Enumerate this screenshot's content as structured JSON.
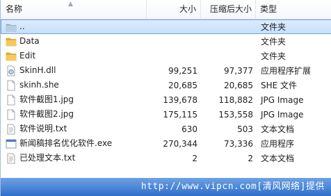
{
  "columns": {
    "name": "名称",
    "size": "大小",
    "compressed_size": "压缩后大小",
    "type": "类型"
  },
  "files": [
    {
      "name": "..",
      "size": "",
      "compressed_size": "",
      "type": "文件夹",
      "icon": "folder-up-icon",
      "selected": true
    },
    {
      "name": "Data",
      "size": "",
      "compressed_size": "",
      "type": "文件夹",
      "icon": "folder-icon",
      "selected": false
    },
    {
      "name": "Edit",
      "size": "",
      "compressed_size": "",
      "type": "文件夹",
      "icon": "folder-icon",
      "selected": false
    },
    {
      "name": "SkinH.dll",
      "size": "99,251",
      "compressed_size": "97,377",
      "type": "应用程序扩展",
      "icon": "dll-file-icon",
      "selected": false
    },
    {
      "name": "skinh.she",
      "size": "20,685",
      "compressed_size": "20,685",
      "type": "SHE 文件",
      "icon": "blank-file-icon",
      "selected": false
    },
    {
      "name": "软件截图1.jpg",
      "size": "139,678",
      "compressed_size": "118,882",
      "type": "JPG Image",
      "icon": "blank-file-icon",
      "selected": false
    },
    {
      "name": "软件截图2.jpg",
      "size": "175,115",
      "compressed_size": "153,558",
      "type": "JPG Image",
      "icon": "blank-file-icon",
      "selected": false
    },
    {
      "name": "软件说明.txt",
      "size": "630",
      "compressed_size": "503",
      "type": "文本文档",
      "icon": "text-file-icon",
      "selected": false
    },
    {
      "name": "新闻稿排名优化软件.exe",
      "size": "270,344",
      "compressed_size": "73,336",
      "type": "应用程序",
      "icon": "exe-file-icon",
      "selected": false
    },
    {
      "name": "已处理文本.txt",
      "size": "2",
      "compressed_size": "2",
      "type": "文本文档",
      "icon": "text-file-icon",
      "selected": false
    }
  ],
  "watermark": "http://www.vipcn.com[清风网络]提供",
  "colors": {
    "selection_bg": "#cce4fc",
    "selection_border": "#7da2ce",
    "folder": "#f2c34c",
    "watermark_bg": "#3f7fd4"
  }
}
